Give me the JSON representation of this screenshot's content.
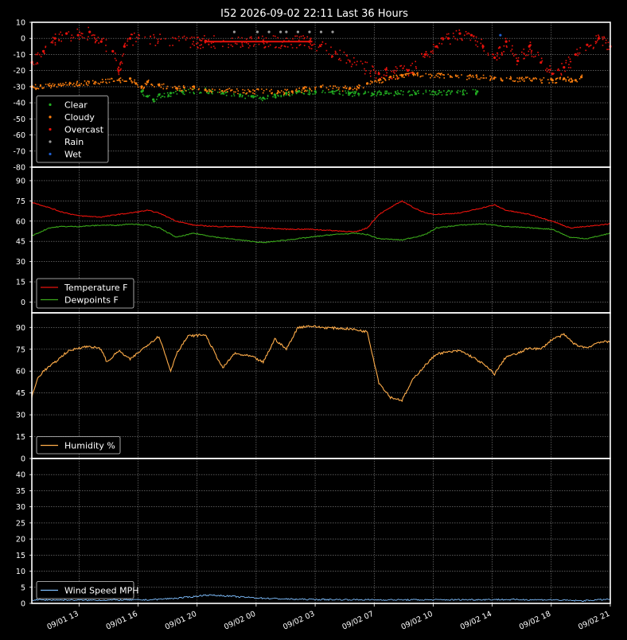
{
  "title": "I52 2026-09-02 22:11 Last 36 Hours",
  "x_tick_labels": [
    "09/01 13",
    "09/01 16",
    "09/01 20",
    "09/02 00",
    "09/02 03",
    "09/02 07",
    "09/02 10",
    "09/02 14",
    "09/02 18",
    "09/02 21"
  ],
  "colors": {
    "background": "#000000",
    "clear": "#22b022",
    "cloudy": "#ff7f0e",
    "overcast": "#e8120c",
    "rain": "#9a9a9a",
    "wet": "#1f5fd0",
    "temperature": "#e8120c",
    "dewpoint": "#3aa71a",
    "humidity": "#ffad4a",
    "wind": "#7fbfff"
  },
  "chart_data": [
    {
      "type": "scatter",
      "panel": "sky",
      "ylim": [
        -80,
        10
      ],
      "yticks": [
        10,
        0,
        -10,
        -20,
        -30,
        -40,
        -50,
        -60,
        -70,
        -80
      ],
      "legend": [
        "Clear",
        "Cloudy",
        "Overcast",
        "Rain",
        "Wet"
      ],
      "legend_position": "lower-left",
      "grid": true,
      "series": [
        {
          "name": "Clear",
          "points": [
            [
              0.19,
              -33
            ],
            [
              0.2,
              -36
            ],
            [
              0.21,
              -38
            ],
            [
              0.22,
              -35
            ],
            [
              0.24,
              -34
            ],
            [
              0.26,
              -33
            ],
            [
              0.3,
              -32
            ],
            [
              0.33,
              -34
            ],
            [
              0.36,
              -35
            ],
            [
              0.38,
              -36
            ],
            [
              0.4,
              -37
            ],
            [
              0.42,
              -35
            ],
            [
              0.44,
              -34
            ],
            [
              0.46,
              -33
            ],
            [
              0.49,
              -33
            ],
            [
              0.52,
              -33
            ],
            [
              0.55,
              -34
            ],
            [
              0.77,
              -33
            ]
          ]
        },
        {
          "name": "Cloudy",
          "points": [
            [
              0.0,
              -30
            ],
            [
              0.17,
              -25
            ],
            [
              0.18,
              -28
            ],
            [
              0.19,
              -30
            ],
            [
              0.2,
              -27
            ],
            [
              0.22,
              -29
            ],
            [
              0.25,
              -31
            ],
            [
              0.28,
              -30
            ],
            [
              0.3,
              -32
            ],
            [
              0.45,
              -33
            ],
            [
              0.47,
              -31
            ],
            [
              0.5,
              -30
            ],
            [
              0.55,
              -31
            ],
            [
              0.58,
              -28
            ],
            [
              0.6,
              -26
            ],
            [
              0.62,
              -24
            ],
            [
              0.64,
              -23
            ],
            [
              0.66,
              -22
            ],
            [
              0.9,
              -26
            ],
            [
              0.92,
              -25
            ],
            [
              0.94,
              -26
            ],
            [
              0.95,
              -24
            ]
          ]
        },
        {
          "name": "Overcast",
          "points": [
            [
              0.0,
              -15
            ],
            [
              0.02,
              -8
            ],
            [
              0.04,
              0
            ],
            [
              0.06,
              3
            ],
            [
              0.08,
              2
            ],
            [
              0.1,
              4
            ],
            [
              0.12,
              -2
            ],
            [
              0.14,
              -8
            ],
            [
              0.15,
              -20
            ],
            [
              0.16,
              -5
            ],
            [
              0.17,
              0
            ],
            [
              0.3,
              -2
            ],
            [
              0.4,
              -2
            ],
            [
              0.48,
              -2
            ],
            [
              0.6,
              -22
            ],
            [
              0.65,
              -20
            ],
            [
              0.68,
              -10
            ],
            [
              0.7,
              -5
            ],
            [
              0.72,
              0
            ],
            [
              0.74,
              3
            ],
            [
              0.76,
              2
            ],
            [
              0.78,
              -5
            ],
            [
              0.8,
              -12
            ],
            [
              0.82,
              -2
            ],
            [
              0.84,
              -14
            ],
            [
              0.86,
              -5
            ],
            [
              0.88,
              -15
            ],
            [
              0.9,
              -22
            ],
            [
              0.92,
              -18
            ],
            [
              0.94,
              -10
            ],
            [
              0.96,
              -4
            ],
            [
              0.98,
              0
            ],
            [
              1.0,
              -5
            ]
          ]
        },
        {
          "name": "Rain",
          "points": [
            [
              0.35,
              4
            ],
            [
              0.39,
              4
            ],
            [
              0.41,
              4
            ],
            [
              0.43,
              4
            ],
            [
              0.44,
              4
            ],
            [
              0.46,
              4
            ],
            [
              0.48,
              4
            ],
            [
              0.5,
              4
            ],
            [
              0.52,
              4
            ]
          ]
        },
        {
          "name": "Wet",
          "points": [
            [
              0.81,
              2
            ]
          ]
        }
      ]
    },
    {
      "type": "line",
      "panel": "temperature",
      "ylim": [
        -8,
        100
      ],
      "yticks": [
        0,
        15,
        30,
        45,
        60,
        75,
        90
      ],
      "legend_position": "lower-left",
      "grid": true,
      "x": [
        0.0,
        0.03,
        0.05,
        0.08,
        0.12,
        0.15,
        0.17,
        0.2,
        0.22,
        0.25,
        0.28,
        0.32,
        0.36,
        0.4,
        0.44,
        0.48,
        0.52,
        0.56,
        0.58,
        0.6,
        0.64,
        0.66,
        0.68,
        0.7,
        0.74,
        0.78,
        0.8,
        0.82,
        0.86,
        0.9,
        0.93,
        0.96,
        1.0
      ],
      "series": [
        {
          "name": "Temperature F",
          "values": [
            74,
            70,
            67,
            64,
            63,
            65,
            66,
            68,
            66,
            60,
            57,
            56,
            56,
            55,
            54,
            54,
            53,
            52,
            55,
            65,
            75,
            70,
            66,
            65,
            66,
            70,
            72,
            68,
            65,
            60,
            55,
            56,
            58
          ]
        },
        {
          "name": "Dewpoints F",
          "values": [
            49,
            55,
            56,
            56,
            57,
            57,
            58,
            57,
            55,
            48,
            51,
            48,
            46,
            44,
            46,
            48,
            50,
            51,
            50,
            47,
            46,
            48,
            50,
            55,
            57,
            58,
            57,
            56,
            55,
            54,
            48,
            47,
            51
          ]
        }
      ]
    },
    {
      "type": "line",
      "panel": "humidity",
      "ylim": [
        0,
        100
      ],
      "yticks": [
        0,
        15,
        30,
        45,
        60,
        75,
        90
      ],
      "legend_position": "lower-left",
      "grid": true,
      "x": [
        0.0,
        0.01,
        0.02,
        0.04,
        0.06,
        0.08,
        0.1,
        0.12,
        0.13,
        0.15,
        0.17,
        0.2,
        0.22,
        0.24,
        0.25,
        0.27,
        0.3,
        0.33,
        0.35,
        0.38,
        0.4,
        0.42,
        0.44,
        0.46,
        0.48,
        0.5,
        0.55,
        0.58,
        0.6,
        0.62,
        0.64,
        0.66,
        0.68,
        0.7,
        0.72,
        0.74,
        0.76,
        0.78,
        0.8,
        0.82,
        0.84,
        0.86,
        0.88,
        0.9,
        0.92,
        0.94,
        0.96,
        0.98,
        1.0
      ],
      "series": [
        {
          "name": "Humidity %",
          "values": [
            42,
            55,
            60,
            66,
            73,
            76,
            77,
            75,
            66,
            74,
            68,
            78,
            84,
            60,
            72,
            84,
            85,
            62,
            72,
            70,
            66,
            82,
            75,
            90,
            91,
            90,
            89,
            87,
            52,
            42,
            40,
            55,
            64,
            72,
            73,
            74,
            70,
            65,
            58,
            70,
            72,
            76,
            75,
            82,
            85,
            78,
            76,
            80,
            80
          ]
        }
      ]
    },
    {
      "type": "line",
      "panel": "wind",
      "ylim": [
        0,
        45
      ],
      "yticks": [
        0,
        5,
        10,
        15,
        20,
        25,
        30,
        35,
        40
      ],
      "legend_position": "lower-left",
      "grid": true,
      "x": [
        0.0,
        0.1,
        0.2,
        0.25,
        0.28,
        0.3,
        0.33,
        0.36,
        0.4,
        0.45,
        0.5,
        0.6,
        0.7,
        0.8,
        0.9,
        0.95,
        1.0
      ],
      "series": [
        {
          "name": "Wind Speed MPH",
          "values": [
            1.1,
            1.0,
            1.1,
            1.6,
            2.1,
            2.6,
            2.4,
            2.0,
            1.6,
            1.3,
            1.2,
            1.1,
            1.1,
            1.2,
            1.1,
            0.8,
            1.3
          ]
        }
      ]
    }
  ]
}
